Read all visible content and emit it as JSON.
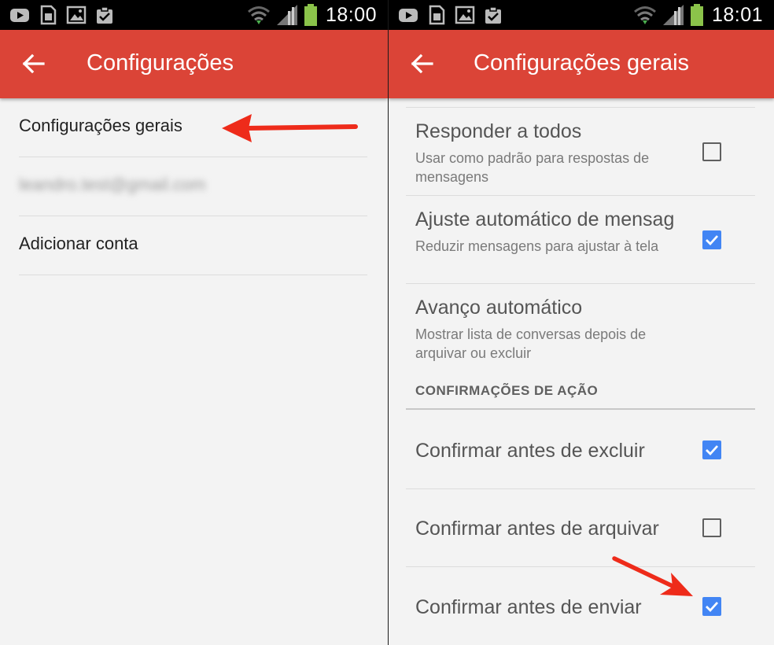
{
  "left": {
    "status": {
      "time": "18:00"
    },
    "appbar": {
      "title": "Configurações"
    },
    "items": [
      {
        "label": "Configurações gerais"
      },
      {
        "label": "leandro.test@gmail.com"
      },
      {
        "label": "Adicionar conta"
      }
    ]
  },
  "right": {
    "status": {
      "time": "18:01"
    },
    "appbar": {
      "title": "Configurações gerais"
    },
    "settings": [
      {
        "title": "Responder a todos",
        "subtitle": "Usar como padrão para respostas de mensagens",
        "checked": false
      },
      {
        "title": "Ajuste automático de mensagens",
        "subtitle": "Reduzir mensagens para ajustar à tela",
        "checked": true
      },
      {
        "title": "Avanço automático",
        "subtitle": "Mostrar lista de conversas depois de arquivar ou excluir"
      }
    ],
    "section_header": "CONFIRMAÇÕES DE AÇÃO",
    "confirmations": [
      {
        "title": "Confirmar antes de excluir",
        "checked": true
      },
      {
        "title": "Confirmar antes de arquivar",
        "checked": false
      },
      {
        "title": "Confirmar antes de enviar",
        "checked": true
      }
    ]
  },
  "colors": {
    "appbar": "#db4437",
    "checkbox_on": "#4285f4",
    "arrow": "#ee2b1a",
    "statusbar": "#000000"
  },
  "icons": [
    "youtube-icon",
    "sim-card-icon",
    "gallery-icon",
    "clipboard-check-icon",
    "wifi-icon",
    "signal-icon",
    "battery-icon",
    "back-arrow-icon",
    "red-pointer-arrow"
  ]
}
